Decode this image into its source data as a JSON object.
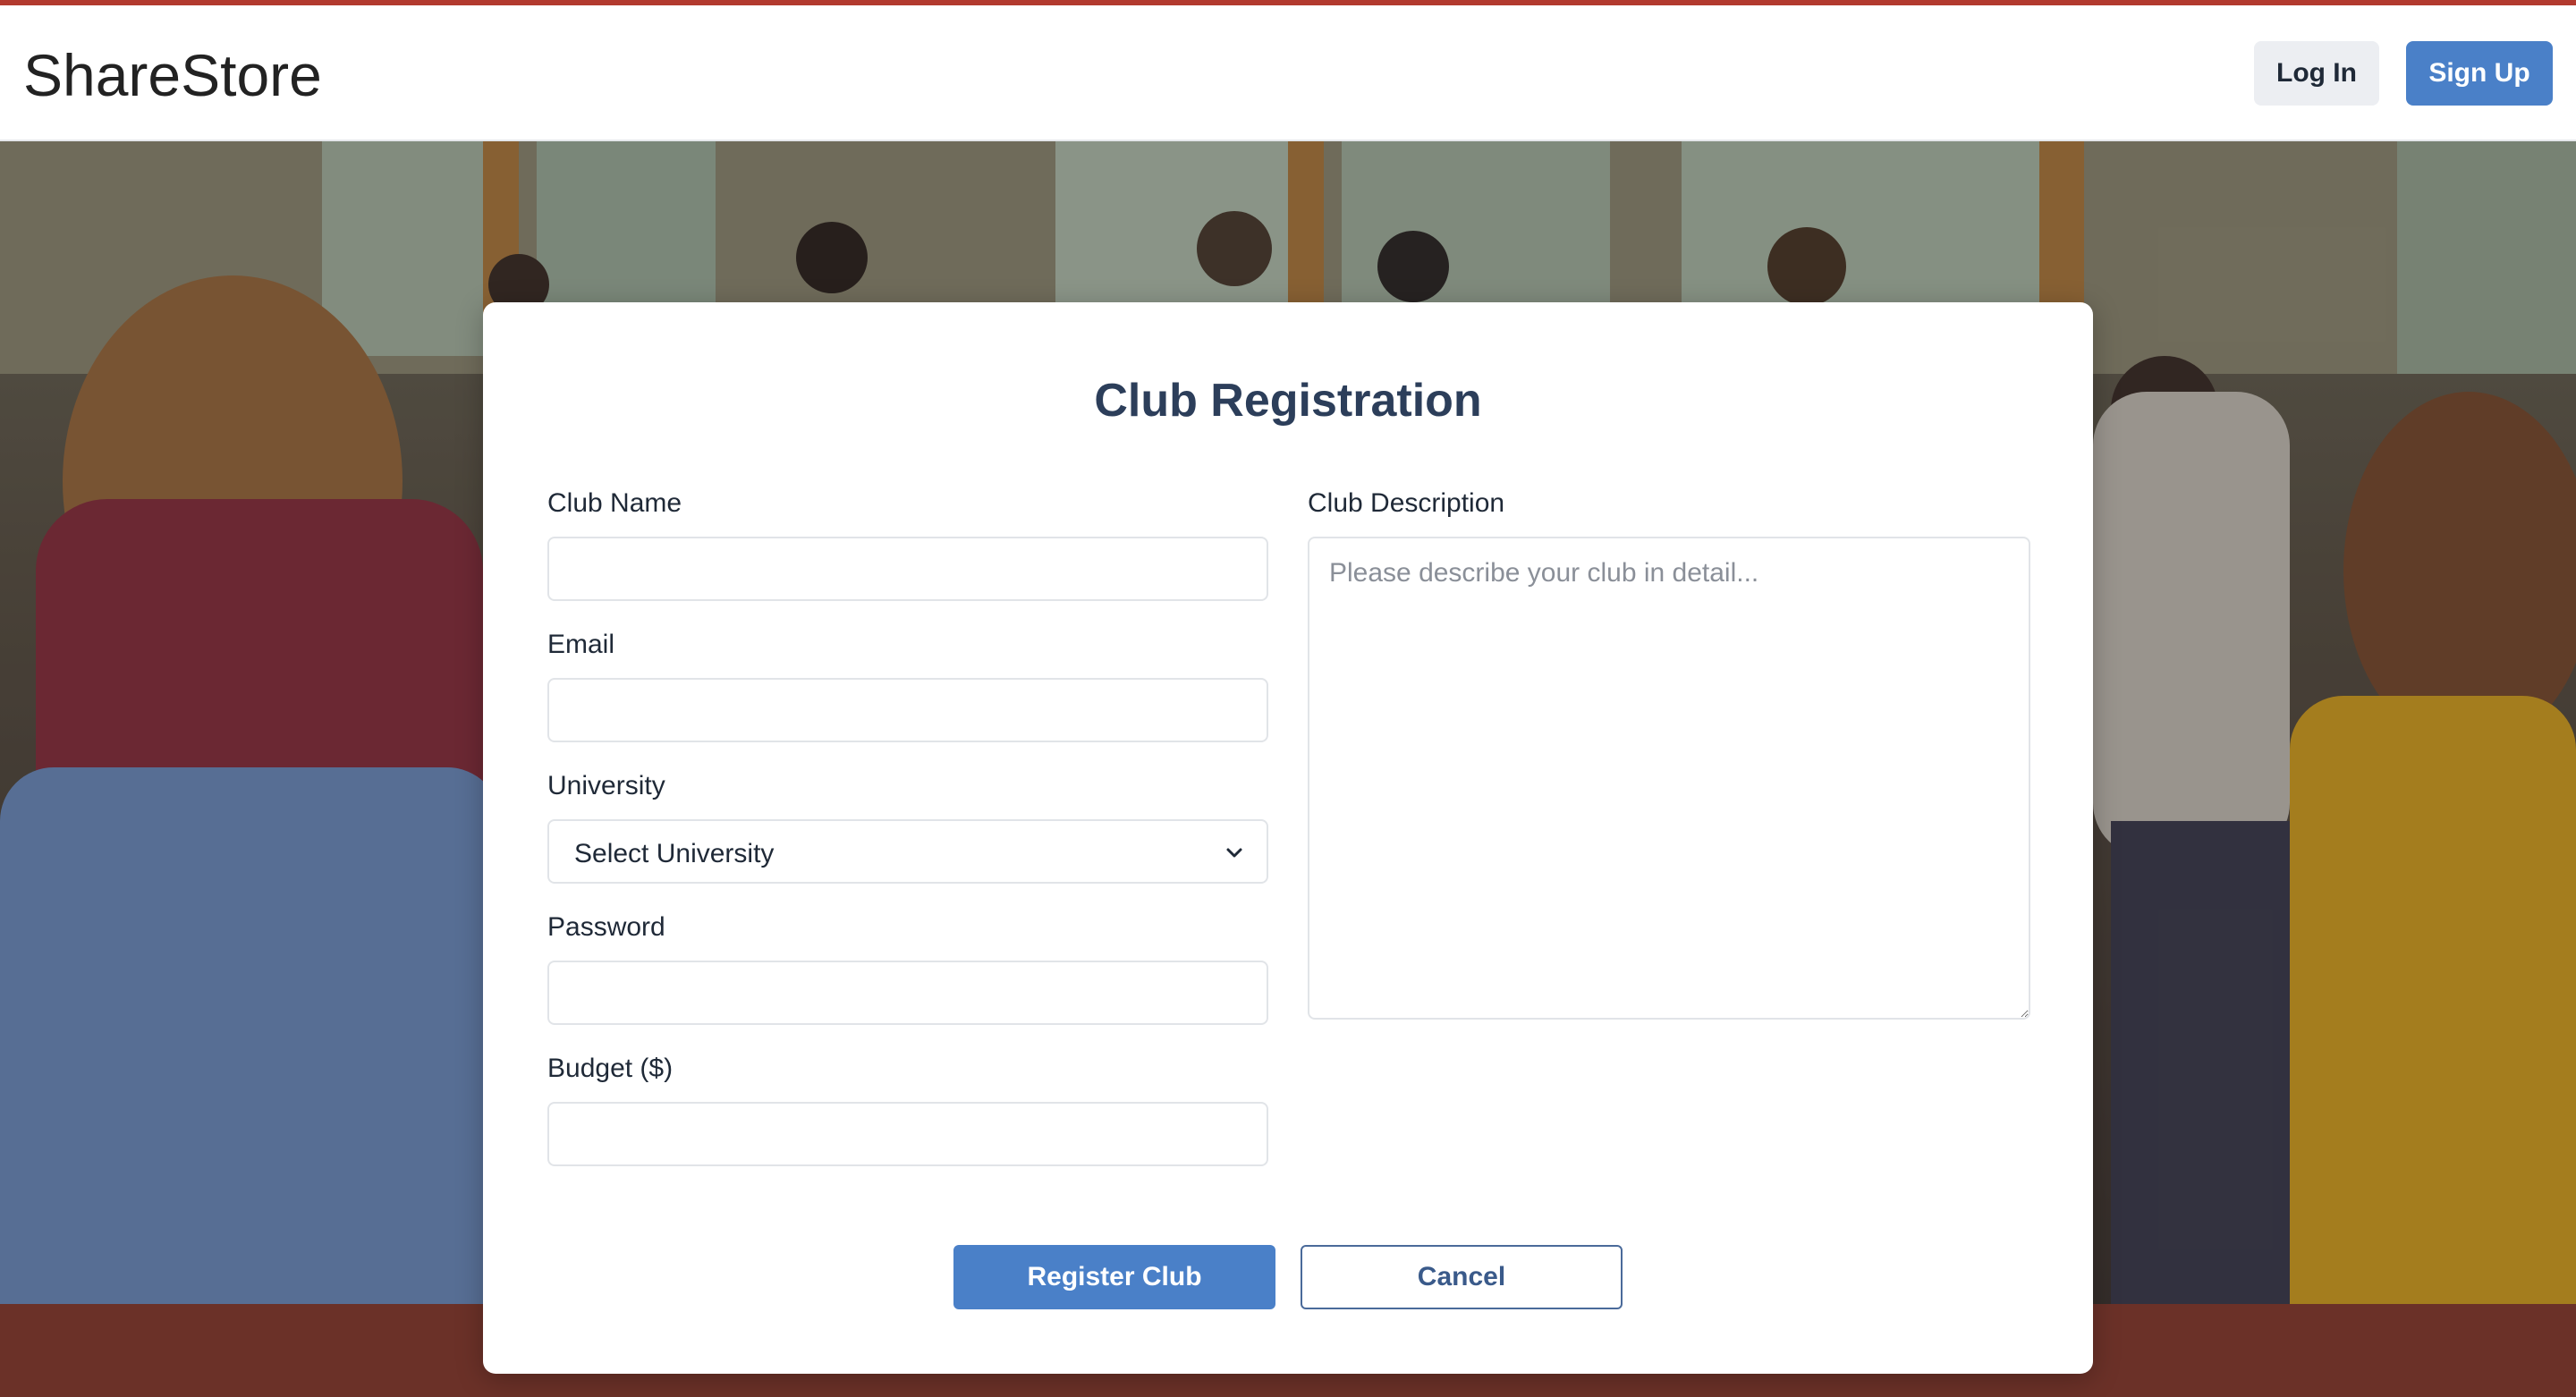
{
  "header": {
    "brand": "ShareStore",
    "login_label": "Log In",
    "signup_label": "Sign Up"
  },
  "form": {
    "title": "Club Registration",
    "club_name": {
      "label": "Club Name",
      "value": ""
    },
    "email": {
      "label": "Email",
      "value": ""
    },
    "university": {
      "label": "University",
      "selected": "Select University"
    },
    "password": {
      "label": "Password",
      "value": ""
    },
    "budget": {
      "label": "Budget ($)",
      "value": ""
    },
    "description": {
      "label": "Club Description",
      "placeholder": "Please describe your club in detail..."
    },
    "register_label": "Register Club",
    "cancel_label": "Cancel"
  },
  "colors": {
    "accent": "#4a80c8",
    "top_border": "#b23a2e",
    "title": "#2c3e5a"
  },
  "icons": {
    "select_chevron": "chevron-down-icon",
    "textarea_grip": "resize-grip-icon"
  }
}
